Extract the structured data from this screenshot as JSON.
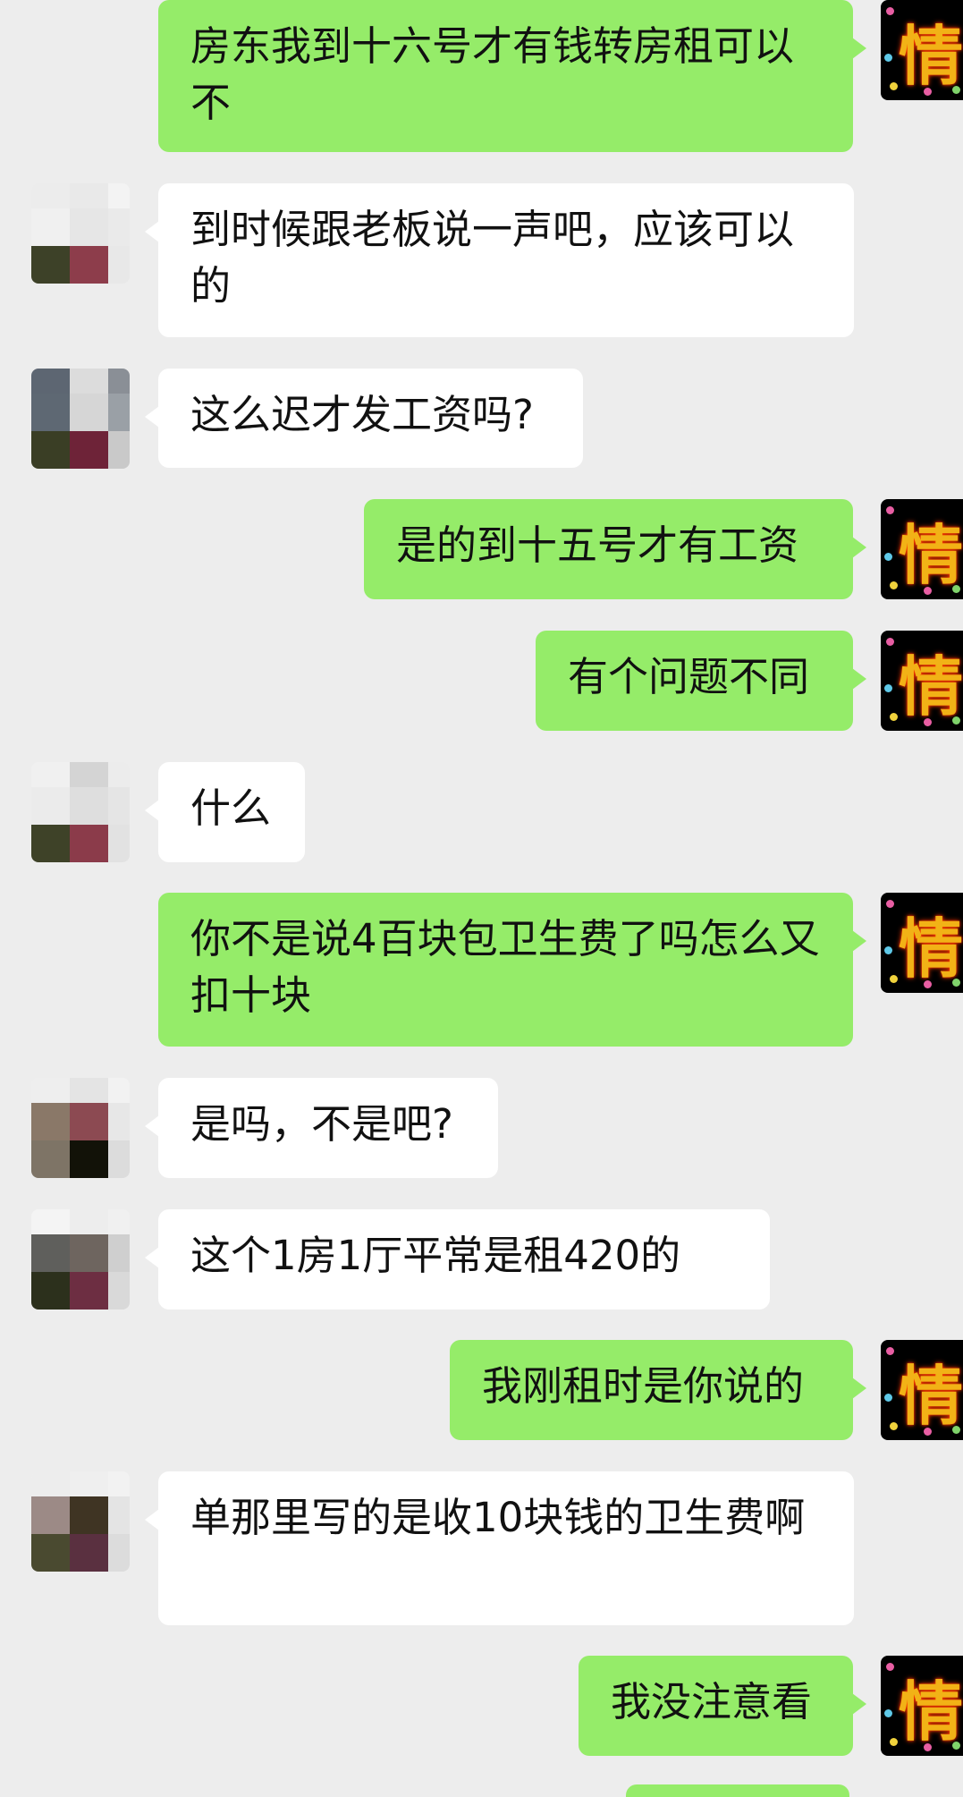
{
  "conversation": {
    "messages": [
      {
        "sender": "self",
        "text": "房东我到十六号才有钱转房租可以不"
      },
      {
        "sender": "other",
        "text": "到时候跟老板说一声吧，应该可以的"
      },
      {
        "sender": "other",
        "text": "这么迟才发工资吗?"
      },
      {
        "sender": "self",
        "text": "是的到十五号才有工资"
      },
      {
        "sender": "self",
        "text": "有个问题不同"
      },
      {
        "sender": "other",
        "text": "什么"
      },
      {
        "sender": "self",
        "text": "你不是说4百块包卫生费了吗怎么又扣十块"
      },
      {
        "sender": "other",
        "text": "是吗，不是吧?"
      },
      {
        "sender": "other",
        "text": "这个1房1厅平常是租420的"
      },
      {
        "sender": "self",
        "text": "我刚租时是你说的"
      },
      {
        "sender": "other",
        "text": "单那里写的是收10块钱的卫生费啊"
      },
      {
        "sender": "self",
        "text": "我没注意看"
      }
    ],
    "self_avatar_char": "情",
    "colors": {
      "background": "#ededed",
      "outgoing_bubble": "#95ec69",
      "incoming_bubble": "#ffffff",
      "text": "#111111"
    }
  }
}
